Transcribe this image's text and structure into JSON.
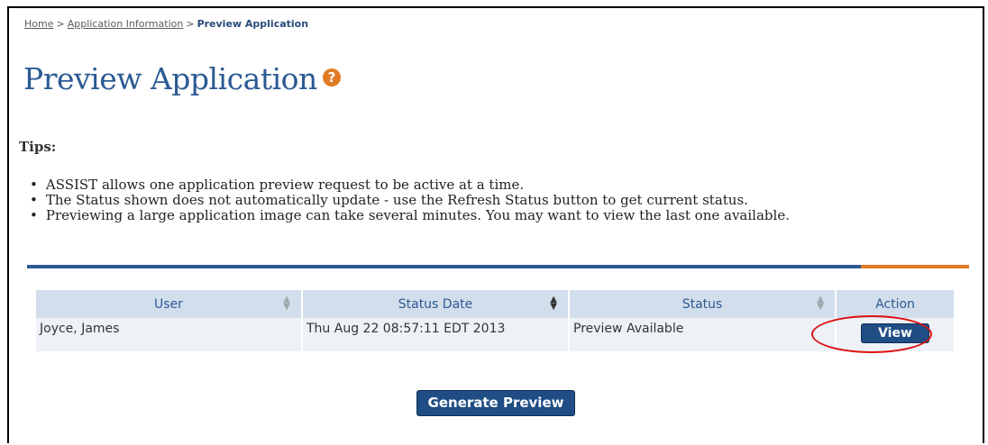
{
  "breadcrumb": {
    "items": [
      "Home",
      "Application Information"
    ],
    "separator": ">",
    "current": "Preview Application"
  },
  "page": {
    "title": "Preview Application",
    "help_icon": "?"
  },
  "tips": {
    "title": "Tips:",
    "items": [
      "ASSIST allows one application preview request to be active at a time.",
      "The Status shown does not automatically update - use the Refresh Status button to get current status.",
      "Previewing a large application image can take several minutes.  You may want to view the last one available."
    ]
  },
  "table": {
    "columns": [
      "User",
      "Status Date",
      "Status",
      "Action"
    ],
    "rows": [
      {
        "user": "Joyce, James",
        "status_date": "Thu Aug 22 08:57:11 EDT 2013",
        "status": "Preview Available",
        "action_label": "View"
      }
    ]
  },
  "actions": {
    "generate_label": "Generate Preview"
  },
  "colors": {
    "brand_blue": "#2b5a93",
    "accent_orange": "#e07b24",
    "button_blue": "#1f4d84",
    "highlight_red": "#dd1111"
  }
}
